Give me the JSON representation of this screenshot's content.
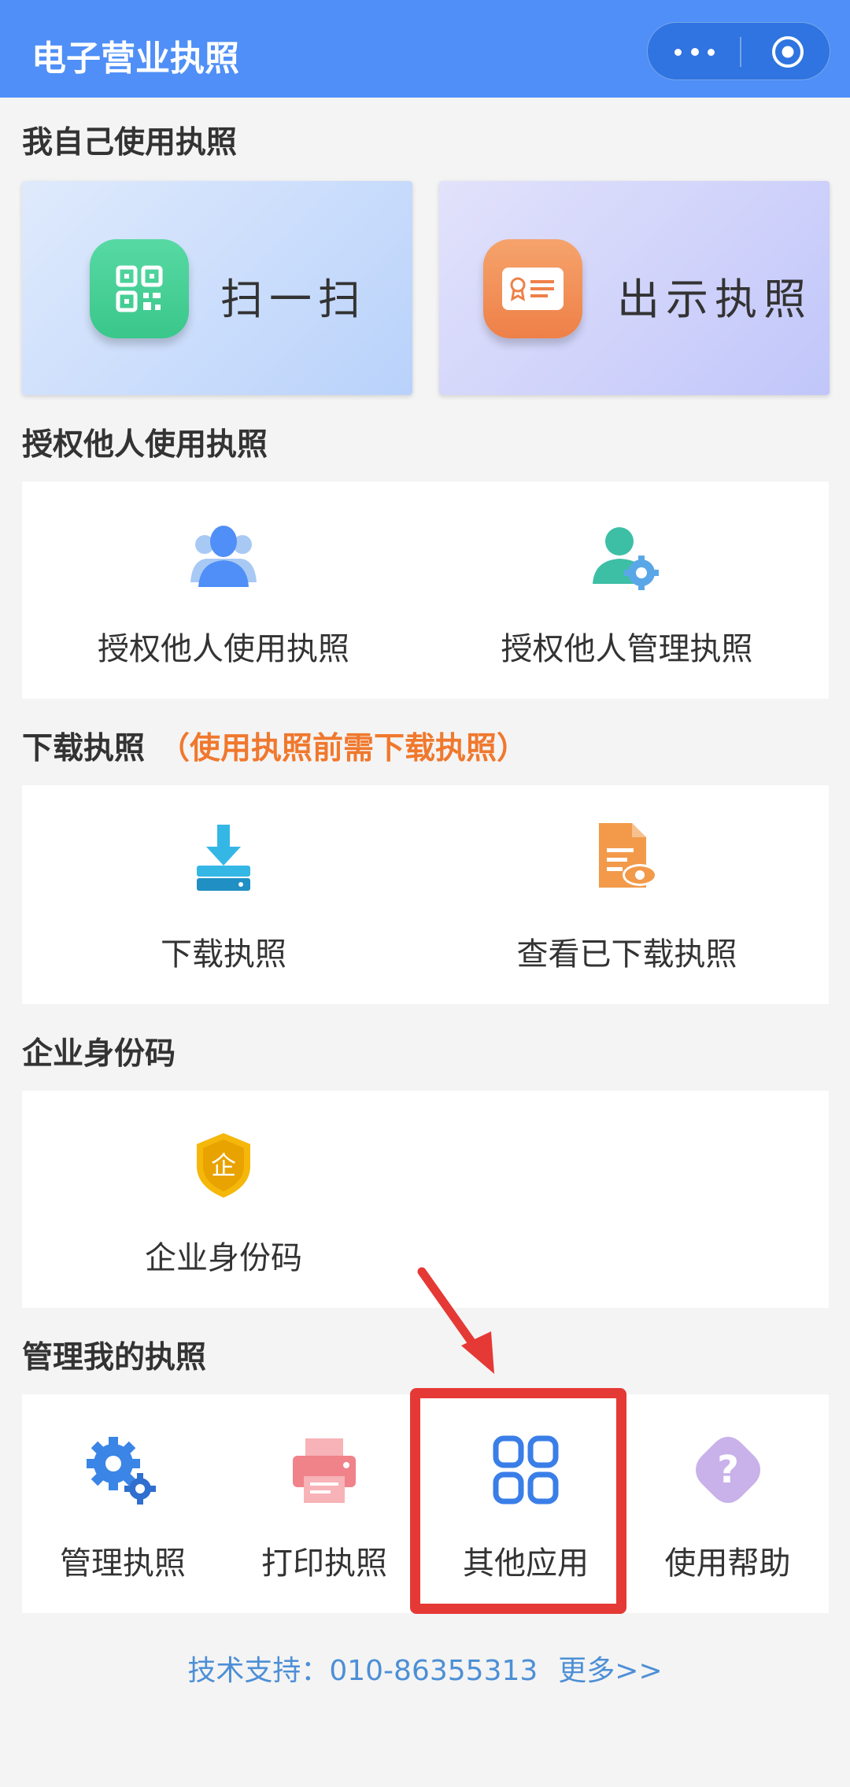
{
  "header": {
    "title": "电子营业执照"
  },
  "sections": {
    "self_use": "我自己使用执照",
    "authorize": "授权他人使用执照",
    "download": "下载执照",
    "download_note": "（使用执照前需下载执照）",
    "identity": "企业身份码",
    "manage": "管理我的执照"
  },
  "self_use": {
    "scan_label": "扫一扫",
    "show_label": "出示执照"
  },
  "authorize": {
    "use_label": "授权他人使用执照",
    "manage_label": "授权他人管理执照"
  },
  "download": {
    "download_label": "下载执照",
    "view_label": "查看已下载执照"
  },
  "identity": {
    "code_label": "企业身份码",
    "icon_char": "企"
  },
  "manage": {
    "manage_label": "管理执照",
    "print_label": "打印执照",
    "other_label": "其他应用",
    "help_label": "使用帮助",
    "help_icon_char": "?"
  },
  "footer": {
    "support": "技术支持：010-86355313",
    "more": "更多>>"
  },
  "colors": {
    "header": "#4f8ff7",
    "accent_orange": "#f0782d",
    "annotation_red": "#e53935",
    "link": "#4d8fd6"
  },
  "icons": {
    "scan": "qr-code-icon",
    "show": "certificate-icon",
    "authorize_use": "users-icon",
    "authorize_manage": "user-gear-icon",
    "download": "download-tray-icon",
    "view": "document-eye-icon",
    "identity": "shield-enterprise-icon",
    "manage": "gears-icon",
    "print": "printer-icon",
    "other": "four-squares-icon",
    "help": "question-icon"
  }
}
